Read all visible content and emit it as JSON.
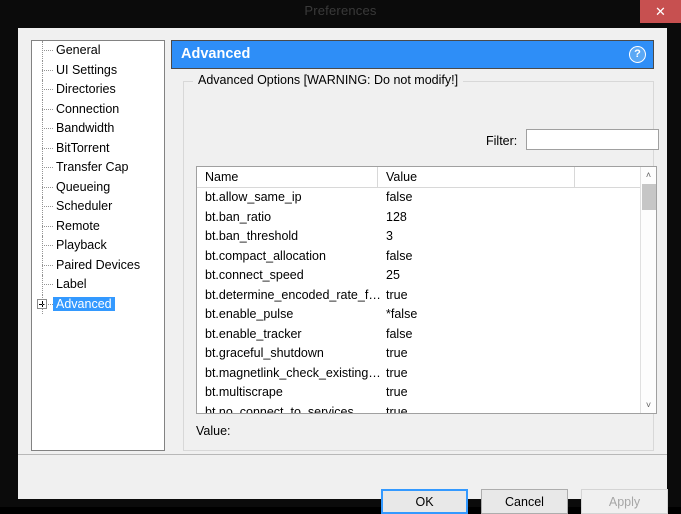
{
  "window": {
    "title": "Preferences",
    "close_label": "✕"
  },
  "sidebar": {
    "items": [
      {
        "label": "General",
        "selected": false,
        "expandable": false
      },
      {
        "label": "UI Settings",
        "selected": false,
        "expandable": false
      },
      {
        "label": "Directories",
        "selected": false,
        "expandable": false
      },
      {
        "label": "Connection",
        "selected": false,
        "expandable": false
      },
      {
        "label": "Bandwidth",
        "selected": false,
        "expandable": false
      },
      {
        "label": "BitTorrent",
        "selected": false,
        "expandable": false
      },
      {
        "label": "Transfer Cap",
        "selected": false,
        "expandable": false
      },
      {
        "label": "Queueing",
        "selected": false,
        "expandable": false
      },
      {
        "label": "Scheduler",
        "selected": false,
        "expandable": false
      },
      {
        "label": "Remote",
        "selected": false,
        "expandable": false
      },
      {
        "label": "Playback",
        "selected": false,
        "expandable": false
      },
      {
        "label": "Paired Devices",
        "selected": false,
        "expandable": false
      },
      {
        "label": "Label",
        "selected": false,
        "expandable": false
      },
      {
        "label": "Advanced",
        "selected": true,
        "expandable": true
      }
    ]
  },
  "page": {
    "header_title": "Advanced",
    "help_icon": "question-mark-icon",
    "help_glyph": "?",
    "groupbox_legend": "Advanced Options [WARNING: Do not modify!]",
    "filter_label": "Filter:",
    "filter_value": "",
    "filter_placeholder": "",
    "value_label": "Value:"
  },
  "table": {
    "columns": [
      "Name",
      "Value",
      ""
    ],
    "rows": [
      {
        "name": "bt.allow_same_ip",
        "value": "false"
      },
      {
        "name": "bt.ban_ratio",
        "value": "128"
      },
      {
        "name": "bt.ban_threshold",
        "value": "3"
      },
      {
        "name": "bt.compact_allocation",
        "value": "false"
      },
      {
        "name": "bt.connect_speed",
        "value": "25"
      },
      {
        "name": "bt.determine_encoded_rate_fo...",
        "value": "true"
      },
      {
        "name": "bt.enable_pulse",
        "value": "*false"
      },
      {
        "name": "bt.enable_tracker",
        "value": "false"
      },
      {
        "name": "bt.graceful_shutdown",
        "value": "true"
      },
      {
        "name": "bt.magnetlink_check_existing_...",
        "value": "true"
      },
      {
        "name": "bt.multiscrape",
        "value": "true"
      },
      {
        "name": "bt.no_connect_to_services",
        "value": "true"
      }
    ],
    "scroll_up_glyph": "˄",
    "scroll_down_glyph": "˅"
  },
  "footer": {
    "ok_label": "OK",
    "cancel_label": "Cancel",
    "apply_label": "Apply"
  },
  "colors": {
    "accent_blue": "#2e8ef7",
    "selection_blue": "#3399ff",
    "close_red": "#c75050",
    "dialog_bg": "#f0f0f0",
    "titlebar_bg": "#0b0b0b"
  }
}
